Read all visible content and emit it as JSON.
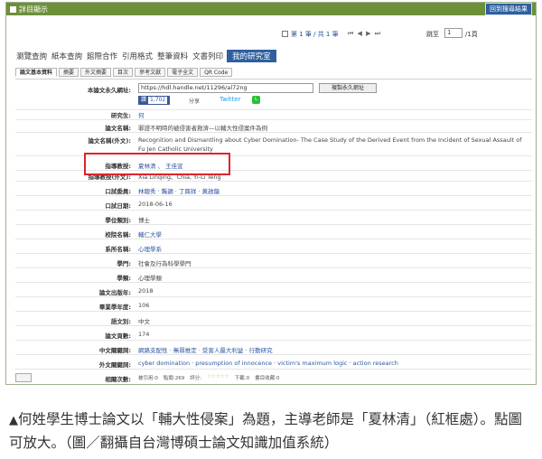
{
  "window": {
    "title": "詳目顯示",
    "right_button": "回到搜尋結果"
  },
  "pager": {
    "count_text": "第 1 筆 / 共 1 筆",
    "nav_arrows": "⏮ ◀ ▶ ⏭",
    "goto_label": "跳至",
    "goto_value": "1",
    "total_pages": "/1頁"
  },
  "menus": [
    "瀏覽查詢",
    "紙本查詢",
    "館際合作",
    "引用格式",
    "整筆資料",
    "文書列印",
    "我的研究室"
  ],
  "menus_active": "我的研究室",
  "tabs": [
    "論文基本資料",
    "摘要",
    "外文摘要",
    "目次",
    "參考文獻",
    "電子全文",
    "QR Code"
  ],
  "record": {
    "permalink_label": "本論文永久網址:",
    "permalink_value": "https://hdl.handle.net/11296/al72ng",
    "copy_button": "複製永久網址",
    "fb_label": "讚",
    "fb_count": "1,702",
    "share_label": "分享",
    "twitter_label": "Twitter",
    "line_label": "LINE",
    "fields": [
      {
        "label": "研究生:",
        "value": "何",
        "link": true
      },
      {
        "label": "論文名稱:",
        "value": "罪證不明時的被侵害者救濟—以輔大性侵案件為例",
        "link": false
      },
      {
        "label": "論文名稱(外文):",
        "value": "Recognition and Dismantling about Cyber Domination- The Case Study of the Derived Event from the Incident of Sexual Assault of Fu Jen Catholic University",
        "link": false
      },
      {
        "label": "指導教授:",
        "value": "夏林清 、 王佳宣",
        "link": true
      },
      {
        "label": "指導教授(外文):",
        "value": "Xia Linqing、Chia, Yi-Li Teng",
        "link": false
      },
      {
        "label": "口試委員:",
        "value": "林聰秀 · 龔韻 · 丁興祥 · 黃啟龍",
        "link": true
      },
      {
        "label": "口試日期:",
        "value": "2018-06-16",
        "link": false
      },
      {
        "label": "學位類別:",
        "value": "博士",
        "link": false
      },
      {
        "label": "校院名稱:",
        "value": "輔仁大學",
        "link": true
      },
      {
        "label": "系所名稱:",
        "value": "心理學系",
        "link": true
      },
      {
        "label": "學門:",
        "value": "社會及行為科學學門",
        "link": false
      },
      {
        "label": "學類:",
        "value": "心理學類",
        "link": false
      },
      {
        "label": "論文出版年:",
        "value": "2018",
        "link": false
      },
      {
        "label": "畢業學年度:",
        "value": "106",
        "link": false
      },
      {
        "label": "語文別:",
        "value": "中文",
        "link": false
      },
      {
        "label": "論文頁數:",
        "value": "174",
        "link": false
      },
      {
        "label": "中文關鍵詞:",
        "value": "網路支配性 · 無罪推定 · 受害人最大利益 · 行動研究",
        "link": true
      },
      {
        "label": "外文關鍵詞:",
        "value": "cyber domination · presumption of innocence · victim's maximum logic · action research",
        "link": true
      },
      {
        "label": "相關次數:",
        "value": "",
        "link": false
      }
    ],
    "rating": {
      "cited": "被引用:0",
      "clicks": "點閱:269",
      "score": "評分:",
      "stars": "☆☆☆☆☆",
      "downloads": "下載:0",
      "bookmarks": "書目收藏:0"
    }
  },
  "caption": {
    "marker": "▲",
    "text": "何姓學生博士論文以「輔大性侵案」為題，主導老師是「夏林清」（紅框處）。點圖可放大。（圖／翻攝自台灣博碩士論文知識加值系統）"
  }
}
